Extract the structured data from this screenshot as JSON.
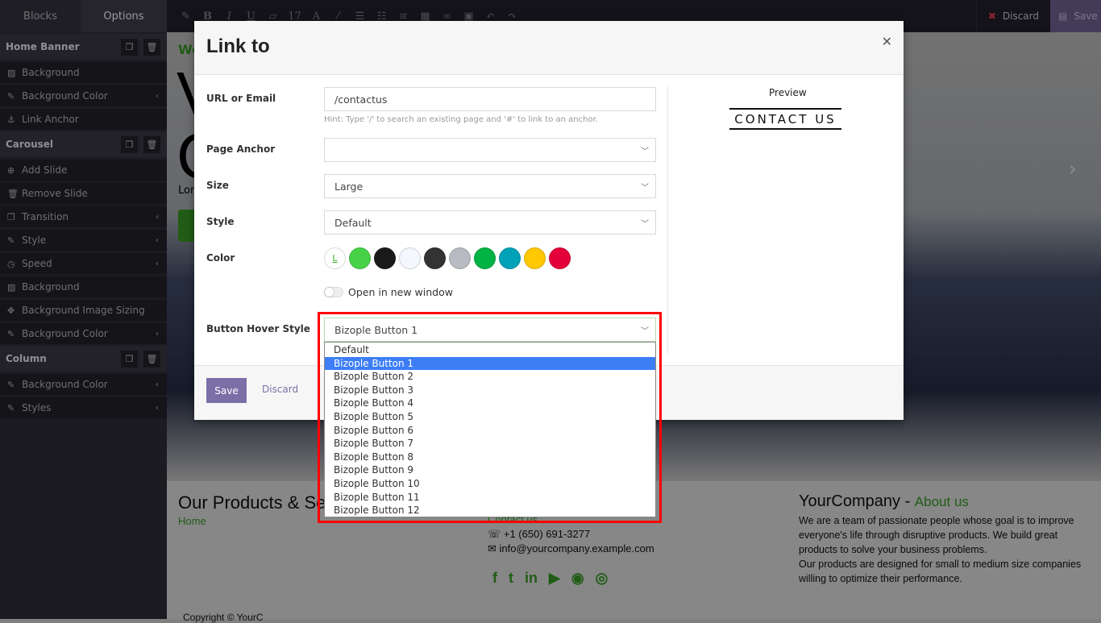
{
  "topbar": {
    "tabs": [
      "Blocks",
      "Options"
    ],
    "font_size": "17",
    "discard": "Discard",
    "save": "Save"
  },
  "sidebar": {
    "home_banner": {
      "title": "Home Banner",
      "items": [
        "Background",
        "Background Color",
        "Link Anchor"
      ]
    },
    "carousel": {
      "title": "Carousel",
      "items": [
        "Add Slide",
        "Remove Slide",
        "Transition",
        "Style",
        "Speed",
        "Background",
        "Background Image Sizing",
        "Background Color"
      ]
    },
    "column": {
      "title": "Column",
      "items": [
        "Background Color",
        "Styles"
      ]
    }
  },
  "page": {
    "hero_heading_fragment": "We",
    "hero_big": "V\nC",
    "hero_text": "Lor",
    "footer": {
      "title": "Our Products & Se",
      "home": "Home",
      "contact": "Contact us",
      "phone": "+1 (650) 691-3277",
      "email": "info@yourcompany.example.com",
      "company": "YourCompany",
      "about": "About us",
      "about_text": "We are a team of passionate people whose goal is to improve everyone's life through disruptive products. We build great products to solve your business problems.\nOur products are designed for small to medium size companies willing to optimize their performance.",
      "copyright": "Copyright © YourC"
    }
  },
  "modal": {
    "title": "Link to",
    "url_label": "URL or Email",
    "url_value": "/contactus",
    "hint": "Hint: Type '/' to search an existing page and '#' to link to an anchor.",
    "anchor_label": "Page Anchor",
    "anchor_value": "",
    "size_label": "Size",
    "size_value": "Large",
    "style_label": "Style",
    "style_value": "Default",
    "color_label": "Color",
    "colors": [
      "#ffffff",
      "#47d147",
      "#1a1a1a",
      "#f4f7fd",
      "#333333",
      "#b9bbc2",
      "#00b343",
      "#00a2b8",
      "#ffc800",
      "#e4003a"
    ],
    "new_window_label": "Open in new window",
    "new_window": false,
    "hover_label": "Button Hover Style",
    "hover_value": "Bizople Button 1",
    "hover_options": [
      "Default",
      "Bizople Button 1",
      "Bizople Button 2",
      "Bizople Button 3",
      "Bizople Button 4",
      "Bizople Button 5",
      "Bizople Button 6",
      "Bizople Button 7",
      "Bizople Button 8",
      "Bizople Button 9",
      "Bizople Button 10",
      "Bizople Button 11",
      "Bizople Button 12"
    ],
    "preview_label": "Preview",
    "preview_button": "CONTACT US",
    "save": "Save",
    "discard": "Discard",
    "color_first_glyph": "L"
  }
}
